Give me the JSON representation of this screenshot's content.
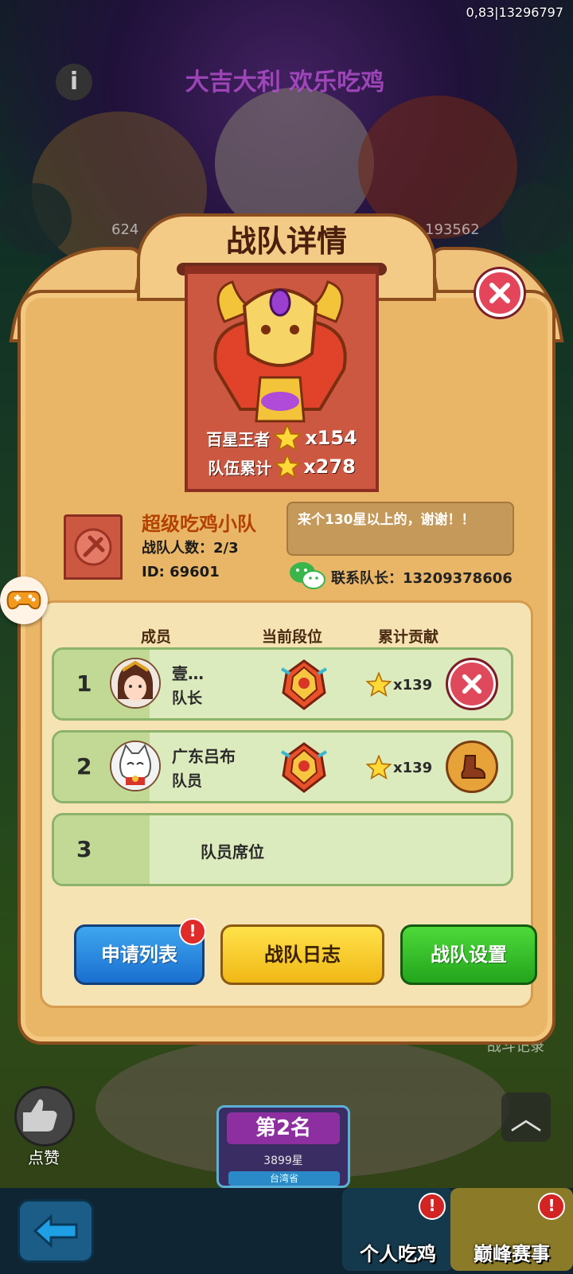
{
  "corner_id": "0,83|13296797",
  "background": {
    "banner_text": "大吉大利 欢乐吃鸡",
    "like_count_left": "624",
    "like_count_right": "193562",
    "side_label": "战斗记录",
    "rank_card": {
      "title": "第2名",
      "stars": "3899星",
      "region": "台湾省"
    },
    "like_label": "点赞"
  },
  "bottom_tabs": [
    {
      "label": "个人吃鸡"
    },
    {
      "label": "巅峰赛事"
    }
  ],
  "dialog": {
    "title": "战队详情",
    "stats": [
      {
        "label": "百星王者",
        "value": "x154"
      },
      {
        "label": "队伍累计",
        "value": "x278"
      }
    ],
    "team": {
      "name": "超级吃鸡小队",
      "count": "战队人数：2/3",
      "id": "ID: 69601",
      "notice": "来个130星以上的，谢谢！！",
      "contact": "联系队长：13209378606"
    },
    "columns": {
      "member": "成员",
      "rank": "当前段位",
      "contribution": "累计贡献"
    },
    "members": [
      {
        "num": "1",
        "name": "壹…",
        "role": "队长",
        "contribution": "x139"
      },
      {
        "num": "2",
        "name": "广东吕布",
        "role": "队员",
        "contribution": "x139"
      },
      {
        "num": "3",
        "seat": "队员席位"
      }
    ],
    "buttons": {
      "apply": "申请列表",
      "log": "战队日志",
      "settings": "战队设置",
      "alert": "!"
    }
  }
}
